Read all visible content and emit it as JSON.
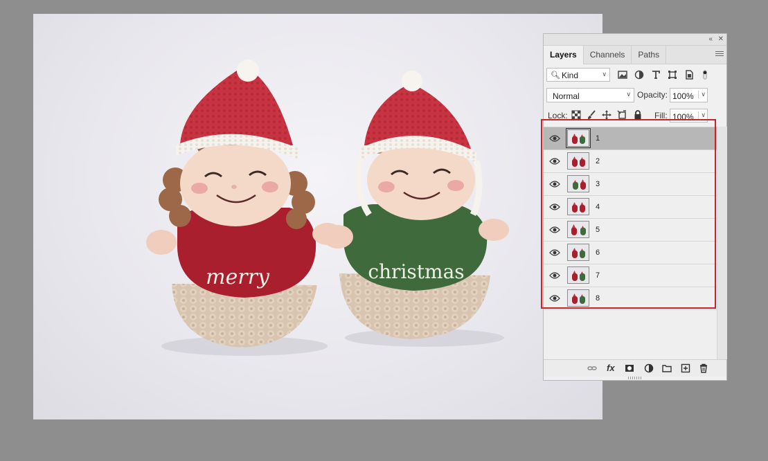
{
  "panel": {
    "tabs": [
      {
        "label": "Layers",
        "active": true
      },
      {
        "label": "Channels",
        "active": false
      },
      {
        "label": "Paths",
        "active": false
      }
    ],
    "filter": {
      "kind_label": "Kind"
    },
    "blend_mode": "Normal",
    "opacity_label": "Opacity:",
    "opacity_value": "100%",
    "lock_label": "Lock:",
    "fill_label": "Fill:",
    "fill_value": "100%",
    "layers": [
      {
        "name": "1",
        "selected": true
      },
      {
        "name": "2",
        "selected": false
      },
      {
        "name": "3",
        "selected": false
      },
      {
        "name": "4",
        "selected": false
      },
      {
        "name": "5",
        "selected": false
      },
      {
        "name": "6",
        "selected": false
      },
      {
        "name": "7",
        "selected": false
      },
      {
        "name": "8",
        "selected": false
      }
    ],
    "highlight_color": "#c8232c"
  },
  "canvas": {
    "left_doll_text": "merry",
    "right_doll_text": "christmas"
  },
  "colors": {
    "workspace": "#8e8e8e",
    "panel_bg": "#f0f0f0",
    "selected_row": "#b7b7b7"
  }
}
